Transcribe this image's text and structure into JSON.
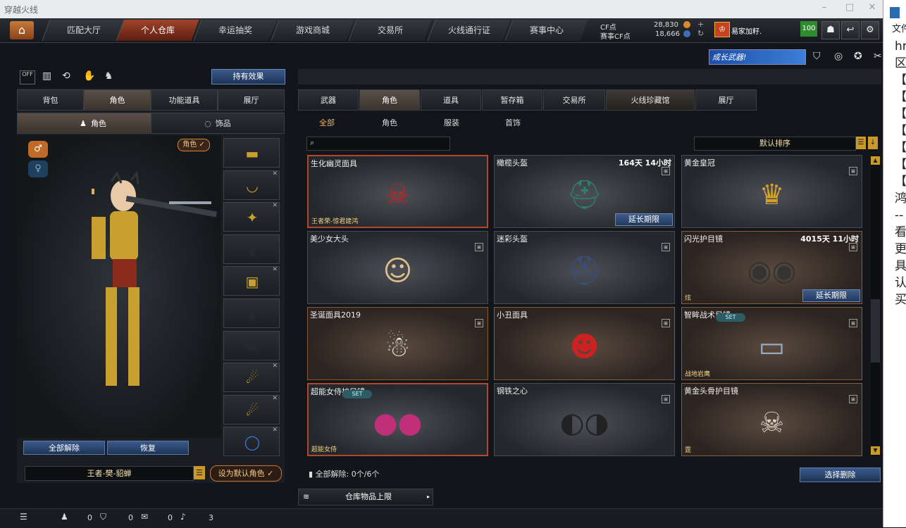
{
  "window": {
    "title": "穿越火线"
  },
  "nav": {
    "tabs": [
      "匹配大厅",
      "个人仓库",
      "幸运抽奖",
      "游戏商城",
      "交易所",
      "火线通行证",
      "赛事中心"
    ],
    "active_index": 1
  },
  "currency": {
    "cf_label": "CF点",
    "cf_value": "28,830",
    "match_cf_label": "赛事CF点",
    "match_cf_value": "18,666"
  },
  "user": {
    "name": "易家加籽.",
    "badge": "100"
  },
  "banner": {
    "text": "成长武器!"
  },
  "left": {
    "effect_button": "持有效果",
    "tabs": [
      "背包",
      "角色",
      "功能道具",
      "展厅"
    ],
    "active_tab": 1,
    "subtabs": [
      "角色",
      "饰品"
    ],
    "character_tag": "角色",
    "unequip_all": "全部解除",
    "restore": "恢复",
    "character_name": "王者-樊-貂蝉",
    "set_default": "设为默认角色"
  },
  "right": {
    "tabs": [
      "武器",
      "角色",
      "道具",
      "暂存箱",
      "交易所",
      "火线珍藏馆",
      "展厅"
    ],
    "active_tab": 1,
    "filters": [
      "全部",
      "角色",
      "服装",
      "首饰"
    ],
    "active_filter": 0,
    "search_placeholder": "",
    "sort_label": "默认排序",
    "items": [
      {
        "name": "生化幽灵面具",
        "sub": "王者荣-惊君建鸿",
        "time": "",
        "ext": "",
        "set": "",
        "icon": "☠",
        "style": "red"
      },
      {
        "name": "橄榄头盔",
        "sub": "",
        "time": "164天 14小时",
        "ext": "延长期限",
        "set": "",
        "icon": "⛑",
        "style": ""
      },
      {
        "name": "黄金皇冠",
        "sub": "",
        "time": "",
        "ext": "",
        "set": "",
        "icon": "♛",
        "style": ""
      },
      {
        "name": "美少女大头",
        "sub": "",
        "time": "",
        "ext": "",
        "set": "",
        "icon": "☺",
        "style": ""
      },
      {
        "name": "迷彩头盔",
        "sub": "",
        "time": "",
        "ext": "",
        "set": "",
        "icon": "⛑",
        "style": ""
      },
      {
        "name": "闪光护目镜",
        "sub": "炫",
        "time": "4015天 11小时",
        "ext": "延长期限",
        "set": "",
        "icon": "◉◉",
        "style": "warm"
      },
      {
        "name": "圣诞面具2019",
        "sub": "",
        "time": "",
        "ext": "",
        "set": "",
        "icon": "☃",
        "style": "warm"
      },
      {
        "name": "小丑面具",
        "sub": "",
        "time": "",
        "ext": "",
        "set": "",
        "icon": "☻",
        "style": "warm"
      },
      {
        "name": "智眸战术目镜",
        "sub": "战地岩鹰",
        "time": "",
        "ext": "",
        "set": "SET",
        "icon": "▭",
        "style": "warm"
      },
      {
        "name": "超能女侍护目镜",
        "sub": "超能女侍",
        "time": "",
        "ext": "",
        "set": "SET",
        "icon": "●●",
        "style": "red"
      },
      {
        "name": "钢铁之心",
        "sub": "",
        "time": "",
        "ext": "",
        "set": "",
        "icon": "◐◑",
        "style": ""
      },
      {
        "name": "黄金头骨护目镜",
        "sub": "霆",
        "time": "",
        "ext": "",
        "set": "",
        "icon": "☠",
        "style": "warm"
      }
    ],
    "unequip_status": "全部解除: 0个/6个",
    "select_delete": "选择删除",
    "storage_limit": "仓库物品上限"
  },
  "statusbar": {
    "count1": "0",
    "count2": "0",
    "count3": "0",
    "count4": "3"
  },
  "side_panel": {
    "lines": [
      "文件",
      "hr",
      "区",
      "【",
      "【",
      "【",
      "【",
      "【",
      "【",
      "【",
      "鸿",
      "--",
      "看",
      "更",
      "具",
      "认",
      "买"
    ]
  }
}
